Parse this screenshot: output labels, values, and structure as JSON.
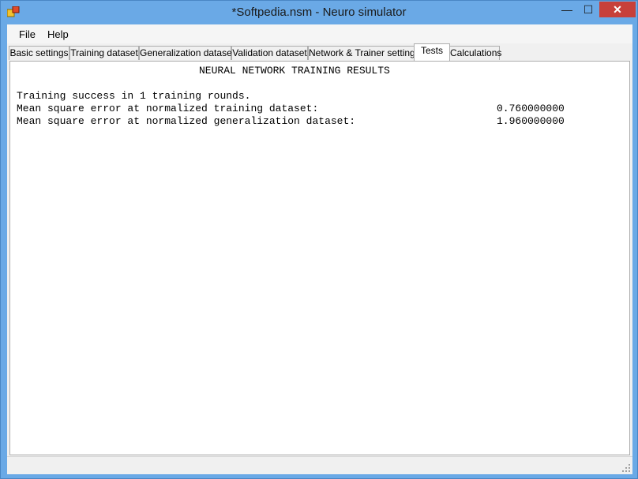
{
  "window": {
    "title": "*Softpedia.nsm - Neuro simulator",
    "min_glyph": "—",
    "max_glyph": "☐",
    "close_glyph": "✕",
    "app_icon": "app-icon"
  },
  "menu": {
    "items": [
      "File",
      "Help"
    ]
  },
  "tabs": [
    {
      "label": "Basic settings"
    },
    {
      "label": "Training dataset"
    },
    {
      "label": "Generalization dataset"
    },
    {
      "label": "Validation dataset"
    },
    {
      "label": "Network & Trainer settings"
    },
    {
      "label": "Tests"
    },
    {
      "label": "Calculations"
    }
  ],
  "active_tab": "Tests",
  "results": {
    "heading": "NEURAL NETWORK TRAINING RESULTS",
    "success_line": "Training success in 1 training rounds.",
    "mse_training_label": "Mean square error at normalized training dataset:",
    "mse_training_value": "0.760000000",
    "mse_generalization_label": "Mean square error at normalized generalization dataset:",
    "mse_generalization_value": "1.960000000"
  }
}
